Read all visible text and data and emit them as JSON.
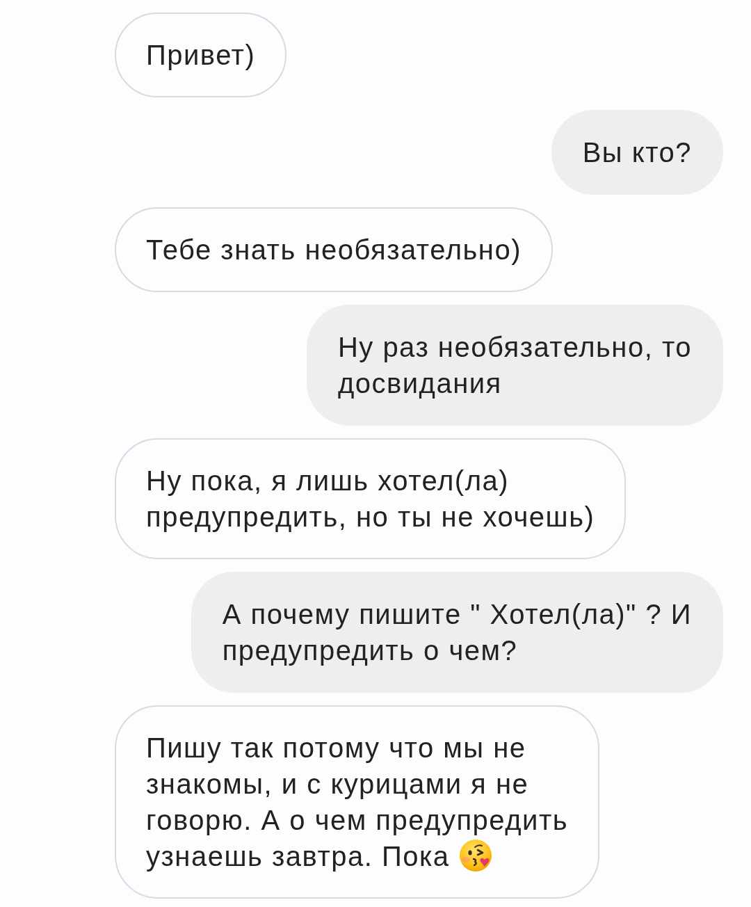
{
  "messages": [
    {
      "kind": "received",
      "lines": [
        "Привет)"
      ],
      "trailing_emoji": false
    },
    {
      "kind": "sent",
      "lines": [
        "Вы кто?"
      ],
      "trailing_emoji": false
    },
    {
      "kind": "received",
      "lines": [
        "Тебе знать необязательно)"
      ],
      "trailing_emoji": false
    },
    {
      "kind": "sent",
      "lines": [
        "Ну раз необязательно, то",
        "досвидания"
      ],
      "trailing_emoji": false
    },
    {
      "kind": "received",
      "lines": [
        "Ну пока, я лишь хотел(ла)",
        "предупредить, но ты не хочешь)"
      ],
      "trailing_emoji": false
    },
    {
      "kind": "sent",
      "lines": [
        "А почему пишите \" Хотел(ла)\" ? И",
        "предупредить о чем?"
      ],
      "trailing_emoji": false
    },
    {
      "kind": "received",
      "lines": [
        "Пишу так потому что мы не",
        "знакомы, и с курицами я не",
        "говорю. А о чем предупредить",
        "узнаешь завтра. Пока"
      ],
      "trailing_emoji": true
    }
  ]
}
